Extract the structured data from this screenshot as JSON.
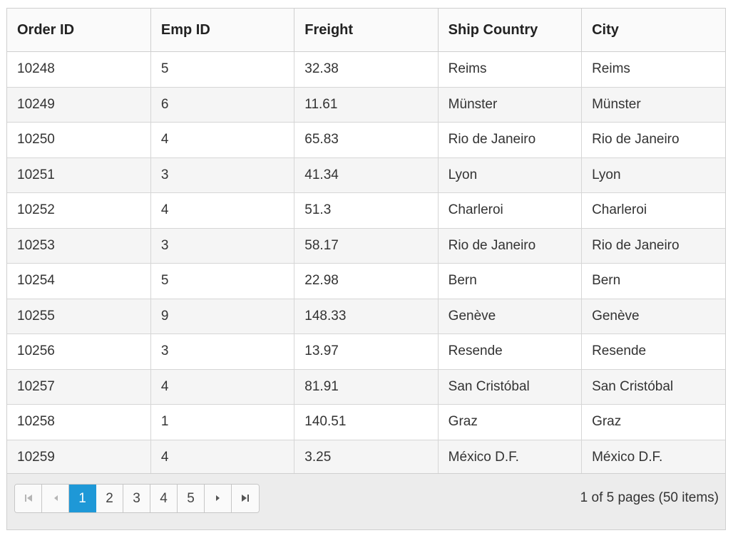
{
  "grid": {
    "columns": [
      "Order ID",
      "Emp ID",
      "Freight",
      "Ship Country",
      "City"
    ],
    "rows": [
      [
        "10248",
        "5",
        "32.38",
        "Reims",
        "Reims"
      ],
      [
        "10249",
        "6",
        "11.61",
        "Münster",
        "Münster"
      ],
      [
        "10250",
        "4",
        "65.83",
        "Rio de Janeiro",
        "Rio de Janeiro"
      ],
      [
        "10251",
        "3",
        "41.34",
        "Lyon",
        "Lyon"
      ],
      [
        "10252",
        "4",
        "51.3",
        "Charleroi",
        "Charleroi"
      ],
      [
        "10253",
        "3",
        "58.17",
        "Rio de Janeiro",
        "Rio de Janeiro"
      ],
      [
        "10254",
        "5",
        "22.98",
        "Bern",
        "Bern"
      ],
      [
        "10255",
        "9",
        "148.33",
        "Genève",
        "Genève"
      ],
      [
        "10256",
        "3",
        "13.97",
        "Resende",
        "Resende"
      ],
      [
        "10257",
        "4",
        "81.91",
        "San Cristóbal",
        "San Cristóbal"
      ],
      [
        "10258",
        "1",
        "140.51",
        "Graz",
        "Graz"
      ],
      [
        "10259",
        "4",
        "3.25",
        "México D.F.",
        "México D.F."
      ]
    ]
  },
  "pager": {
    "pages": [
      "1",
      "2",
      "3",
      "4",
      "5"
    ],
    "current_page": "1",
    "info": "1 of 5 pages (50 items)",
    "icons": [
      "first-page-icon",
      "previous-page-icon",
      "next-page-icon",
      "last-page-icon"
    ]
  },
  "colors": {
    "active_page": "#1e98d7",
    "header_bg": "#fafafa",
    "alt_row_bg": "#f5f5f5",
    "pager_bg": "#ececec",
    "border": "#cfcfcf"
  }
}
